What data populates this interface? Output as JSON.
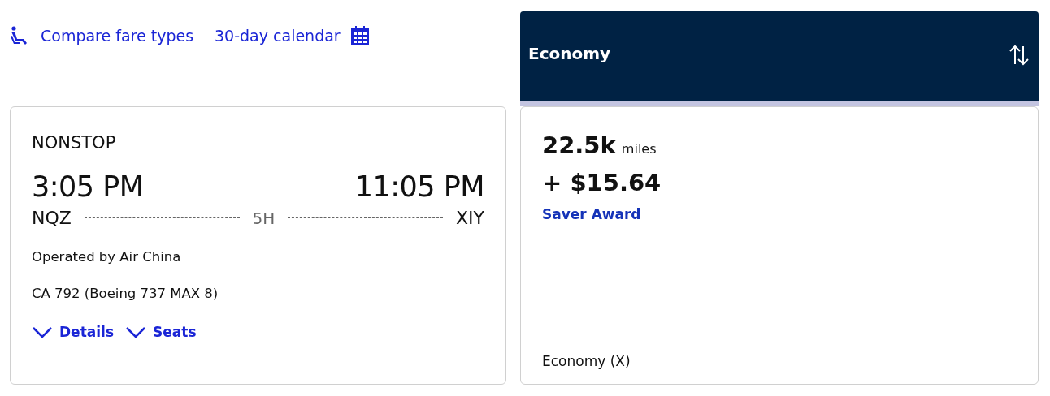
{
  "links": [
    {
      "label": "Compare fare types",
      "kind": "seat"
    },
    {
      "label": "30-day calendar",
      "kind": "calendar"
    }
  ],
  "flight": {
    "stops": "NONSTOP",
    "depart_time": "3:05 PM",
    "arrive_time": "11:05 PM",
    "origin": "NQZ",
    "duration": "5H",
    "destination": "XIY",
    "operator": "Operated by Air China",
    "aircraft": "CA 792 (Boeing 737 MAX 8)",
    "toggles": [
      {
        "label": "Details",
        "expanded": false
      },
      {
        "label": "Seats",
        "expanded": false
      }
    ]
  },
  "fare": {
    "column_title": "Economy",
    "miles": "22.5k",
    "miles_unit": "miles",
    "taxes": "+ $15.64",
    "award_type": "Saver Award",
    "cabin": "Economy (X)"
  }
}
